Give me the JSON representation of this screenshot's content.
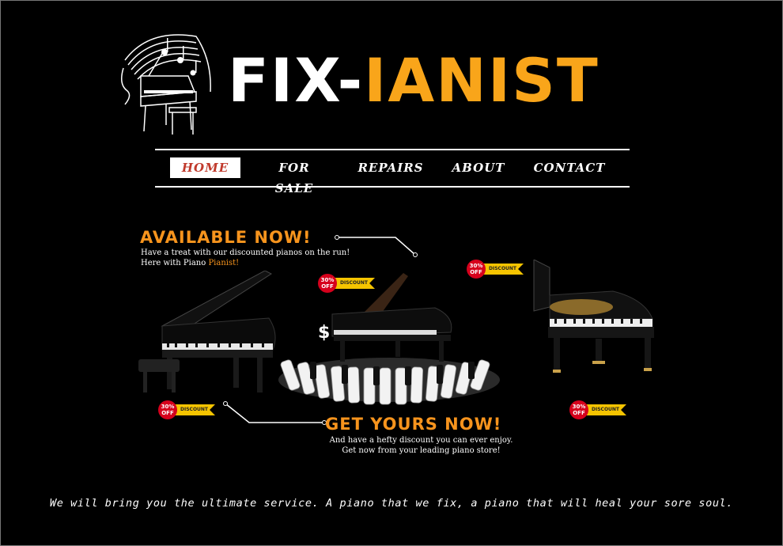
{
  "brand": {
    "part1": "FIX-",
    "part2": "IANIST"
  },
  "nav": [
    {
      "label": "HOME",
      "active": true
    },
    {
      "label": "FOR SALE",
      "active": false
    },
    {
      "label": "REPAIRS",
      "active": false
    },
    {
      "label": "ABOUT",
      "active": false
    },
    {
      "label": "CONTACT",
      "active": false
    }
  ],
  "hero": {
    "available_title": "AVAILABLE NOW!",
    "available_line1": "Have a treat with our discounted pianos on the run!",
    "available_line2_prefix": "Here with Piano ",
    "available_line2_highlight": "Pianist!",
    "get_title": "GET YOURS NOW!",
    "get_line1": "And have a hefty discount you can ever enjoy.",
    "get_line2": "Get now from your leading piano store!",
    "dollar_symbol": "$",
    "badge": {
      "percent": "30%",
      "off": "OFF",
      "label": "DISCOUNT"
    }
  },
  "tagline": "We will bring you the ultimate service. A piano that we fix, a piano that will heal your sore soul.",
  "colors": {
    "accent": "#f9a51a",
    "orange_text": "#f7941d",
    "nav_active": "#c0392b",
    "badge_red": "#d6001c",
    "badge_yellow": "#f5c400"
  }
}
